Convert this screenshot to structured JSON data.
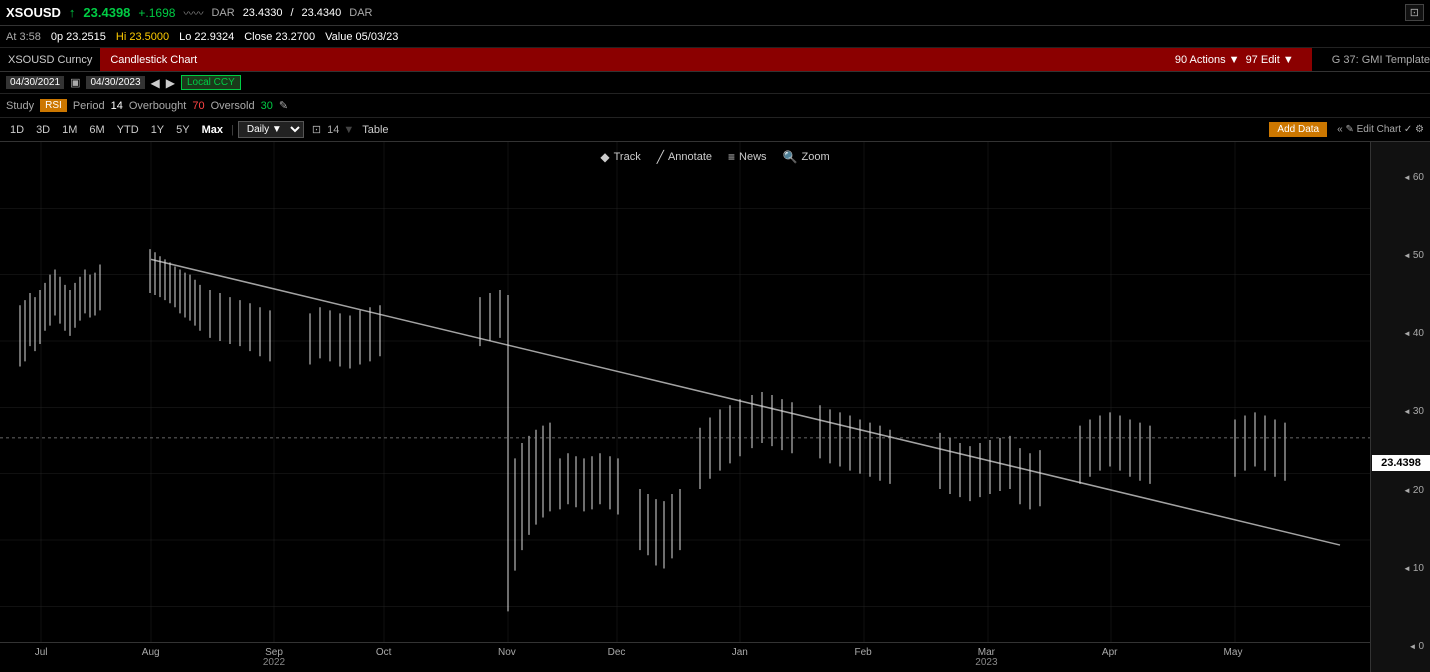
{
  "ticker": {
    "symbol": "XSOUSD",
    "price": "23.4398",
    "change": "+.1698",
    "trend": "↑",
    "dar_bid": "23.4330",
    "dar_ask": "23.4340",
    "dar_label": "DAR",
    "time": "At 3:58",
    "open": "0p 23.2515",
    "high": "Hi 23.5000",
    "low": "Lo 22.9324",
    "close": "Close 23.2700",
    "value_date": "Value 05/03/23"
  },
  "title_bar": {
    "symbol_label": "XSOUSD Curncy",
    "chart_label": "Candlestick Chart",
    "actions": "90 Actions ▼",
    "edit": "97 Edit ▼",
    "template": "G 37: GMI Template"
  },
  "date_range": {
    "from": "04/30/2021",
    "to": "04/30/2023",
    "local_ccy": "Local CCY"
  },
  "study": {
    "label": "Study",
    "type": "RSI",
    "period_label": "Period",
    "period": "14",
    "overbought_label": "Overbought",
    "overbought": "70",
    "oversold_label": "Oversold",
    "oversold": "30"
  },
  "timerange": {
    "buttons": [
      "1D",
      "3D",
      "1M",
      "6M",
      "YTD",
      "1Y",
      "5Y",
      "Max"
    ],
    "active": "Max",
    "interval": "Daily",
    "period_value": "14",
    "table": "Table",
    "add_data": "Add Data",
    "edit_chart": "✎ Edit Chart"
  },
  "chart_toolbar": {
    "track": "Track",
    "annotate": "Annotate",
    "news": "News",
    "zoom": "Zoom"
  },
  "y_axis": {
    "ticks": [
      "60",
      "50",
      "40",
      "30",
      "20",
      "10",
      "0"
    ],
    "current_price": "23.4398"
  },
  "x_axis": {
    "labels": [
      {
        "text": "Jul",
        "pct": 3,
        "year": ""
      },
      {
        "text": "Aug",
        "pct": 11,
        "year": ""
      },
      {
        "text": "Sep",
        "pct": 20,
        "year": ""
      },
      {
        "text": "Oct",
        "pct": 28,
        "year": ""
      },
      {
        "text": "Nov",
        "pct": 37,
        "year": ""
      },
      {
        "text": "Dec",
        "pct": 45,
        "year": ""
      },
      {
        "text": "Jan",
        "pct": 54,
        "year": ""
      },
      {
        "text": "Feb",
        "pct": 63,
        "year": ""
      },
      {
        "text": "Mar",
        "pct": 72,
        "year": ""
      },
      {
        "text": "Apr",
        "pct": 81,
        "year": ""
      },
      {
        "text": "May",
        "pct": 90,
        "year": ""
      }
    ],
    "year_2022": {
      "text": "2022",
      "pct": 20
    },
    "year_2023": {
      "text": "2023",
      "pct": 72
    }
  }
}
